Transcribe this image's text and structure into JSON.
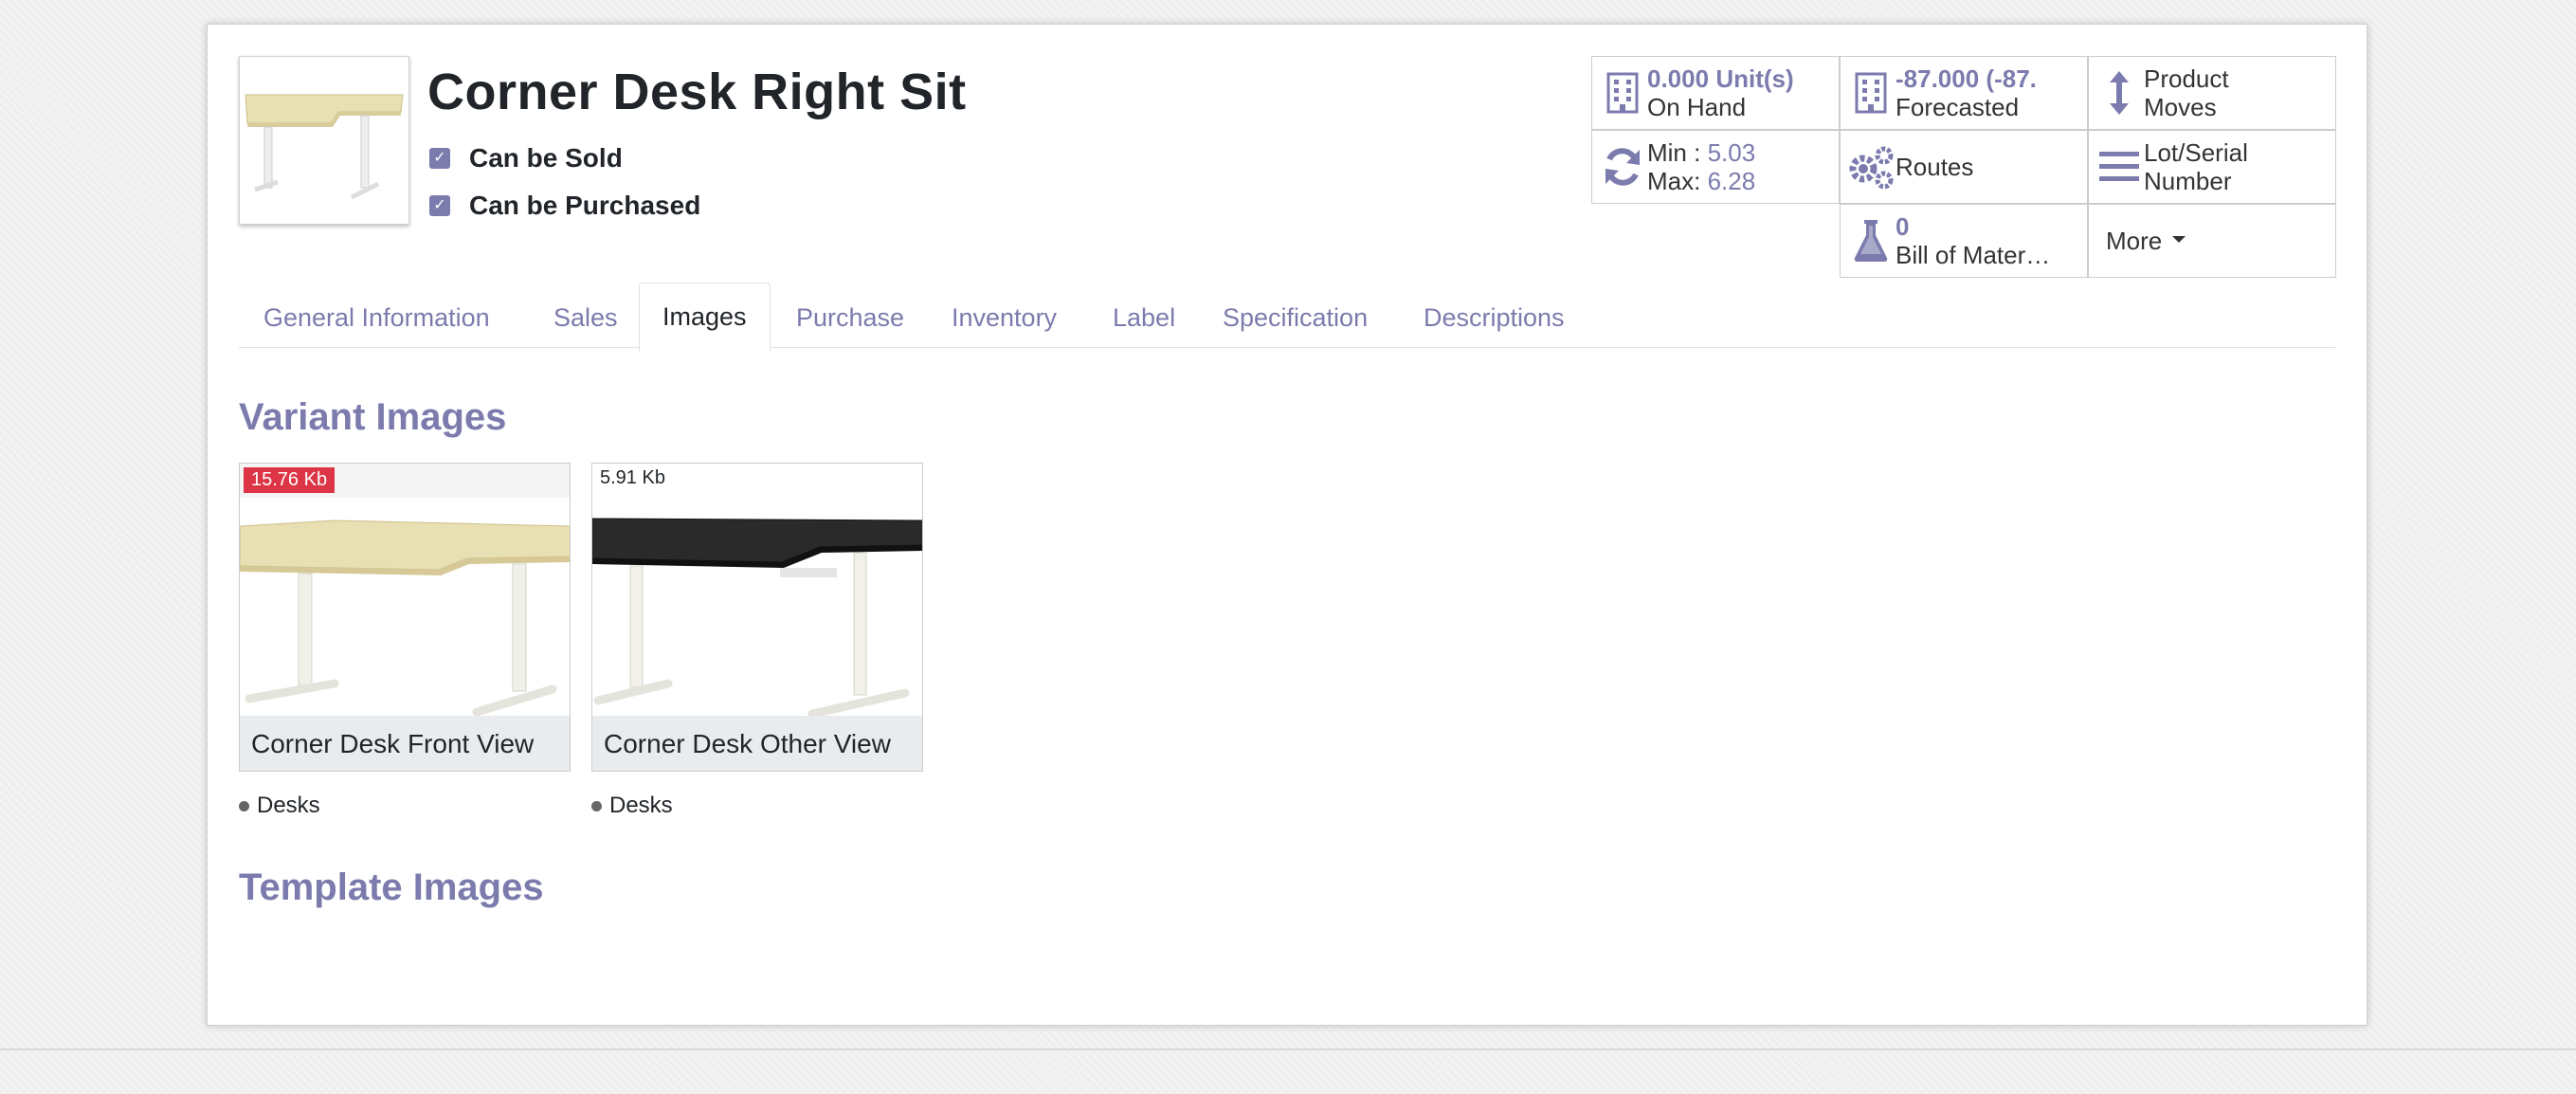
{
  "product": {
    "name": "Corner Desk Right Sit",
    "checks": [
      {
        "label": "Can be Sold",
        "checked": true
      },
      {
        "label": "Can be Purchased",
        "checked": true
      }
    ]
  },
  "stats": {
    "on_hand": {
      "value": "0.000",
      "unit": "Unit(s)",
      "label": "On Hand",
      "icon": "building-icon"
    },
    "forecasted": {
      "value": "-87.000",
      "unit": "(-87.",
      "label": "Forecasted",
      "icon": "building-icon"
    },
    "product_moves": {
      "line1": "Product",
      "line2": "Moves",
      "icon": "up-down-arrow-icon"
    },
    "minmax": {
      "min_label": "Min :",
      "min_value": "5.03",
      "max_label": "Max:",
      "max_value": "6.28",
      "icon": "refresh-icon"
    },
    "routes": {
      "label": "Routes",
      "icon": "gears-icon"
    },
    "lot_serial": {
      "line1": "Lot/Serial",
      "line2": "Number",
      "icon": "bars-icon"
    },
    "bom": {
      "value": "0",
      "label": "Bill of Mater…",
      "icon": "flask-icon"
    },
    "more": {
      "label": "More"
    }
  },
  "tabs": [
    "General Information",
    "Sales",
    "Images",
    "Purchase",
    "Inventory",
    "Label",
    "Specification",
    "Descriptions"
  ],
  "active_tab": "Images",
  "sections": {
    "variant_title": "Variant Images",
    "template_title": "Template Images"
  },
  "variant_images": [
    {
      "size": "15.76 Kb",
      "caption": "Corner Desk Front View",
      "tag": "Desks",
      "desk_top_color": "#e8dfb3"
    },
    {
      "size": "5.91 Kb",
      "caption": "Corner Desk Other View",
      "tag": "Desks",
      "desk_top_color": "#2a2a2a"
    }
  ],
  "colors": {
    "accent": "#7c7bad",
    "badge_red": "#dc3545"
  }
}
